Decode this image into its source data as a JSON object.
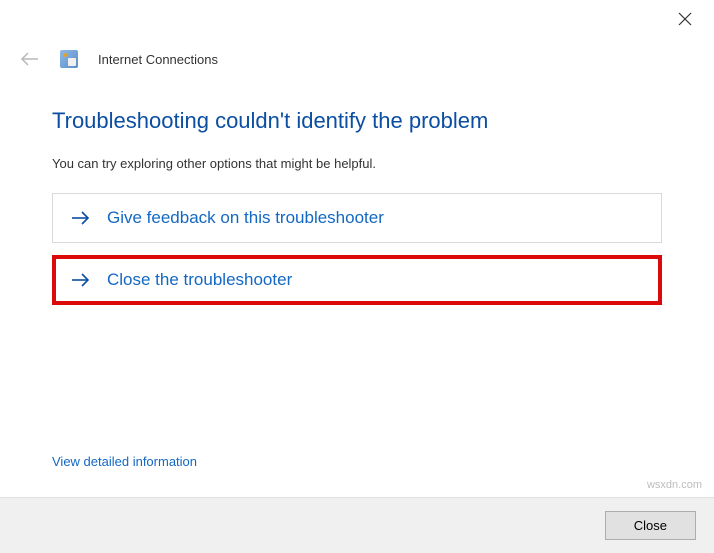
{
  "window": {
    "title": "Internet Connections"
  },
  "main": {
    "heading": "Troubleshooting couldn't identify the problem",
    "description": "You can try exploring other options that might be helpful.",
    "options": [
      {
        "label": "Give feedback on this troubleshooter"
      },
      {
        "label": "Close the troubleshooter"
      }
    ],
    "detail_link": "View detailed information"
  },
  "footer": {
    "close_label": "Close"
  },
  "watermark": "wsxdn.com"
}
